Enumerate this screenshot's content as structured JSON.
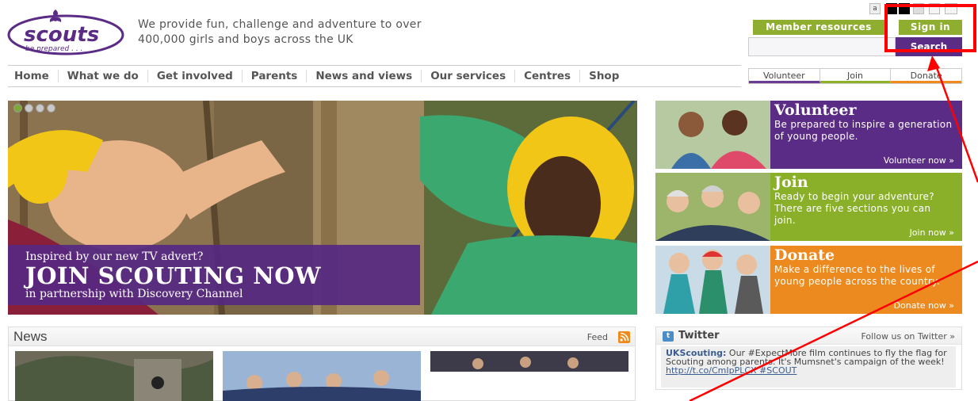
{
  "header": {
    "logo_word": "scouts",
    "logo_motto": "be prepared . . .",
    "tagline": "We provide fun, challenge and adventure to over 400,000 girls and boys across the UK",
    "text_size_label": "a",
    "member_resources_label": "Member resources",
    "sign_in_label": "Sign in",
    "search_placeholder": "",
    "search_button_label": "Search"
  },
  "nav": {
    "items": [
      {
        "label": "Home"
      },
      {
        "label": "What we do"
      },
      {
        "label": "Get involved"
      },
      {
        "label": "Parents"
      },
      {
        "label": "News and views"
      },
      {
        "label": "Our services"
      },
      {
        "label": "Centres"
      },
      {
        "label": "Shop"
      }
    ],
    "quick_links": [
      {
        "label": "Volunteer"
      },
      {
        "label": "Join"
      },
      {
        "label": "Donate"
      }
    ]
  },
  "hero": {
    "slides": 4,
    "active_slide": 1,
    "caption_line1": "Inspired by our new TV advert?",
    "caption_line2": "JOIN SCOUTING NOW",
    "caption_line3": "in partnership with Discovery Channel"
  },
  "promos": [
    {
      "title": "Volunteer",
      "text": "Be prepared to inspire a generation of young people.",
      "link": "Volunteer now »"
    },
    {
      "title": "Join",
      "text": "Ready to begin your adventure? There are five sections you can join.",
      "link": "Join now »"
    },
    {
      "title": "Donate",
      "text": "Make a difference to the lives of young people across the country.",
      "link": "Donate now »"
    }
  ],
  "news": {
    "title": "News",
    "feed_label": "Feed"
  },
  "twitter": {
    "title": "Twitter",
    "follow_label": "Follow us on Twitter »",
    "tweet_user": "UKScouting:",
    "tweet_text": "Our #ExpectMore film continues to fly the flag for Scouting among parents. It's Mumsnet's campaign of the week!",
    "tweet_link": "http://t.co/CmIpPLCX #SCOUT"
  },
  "colors": {
    "brand_purple": "#5b2c86",
    "brand_green": "#8ab02a",
    "brand_orange": "#ec8a1f",
    "annotation_red": "#ff0000"
  }
}
